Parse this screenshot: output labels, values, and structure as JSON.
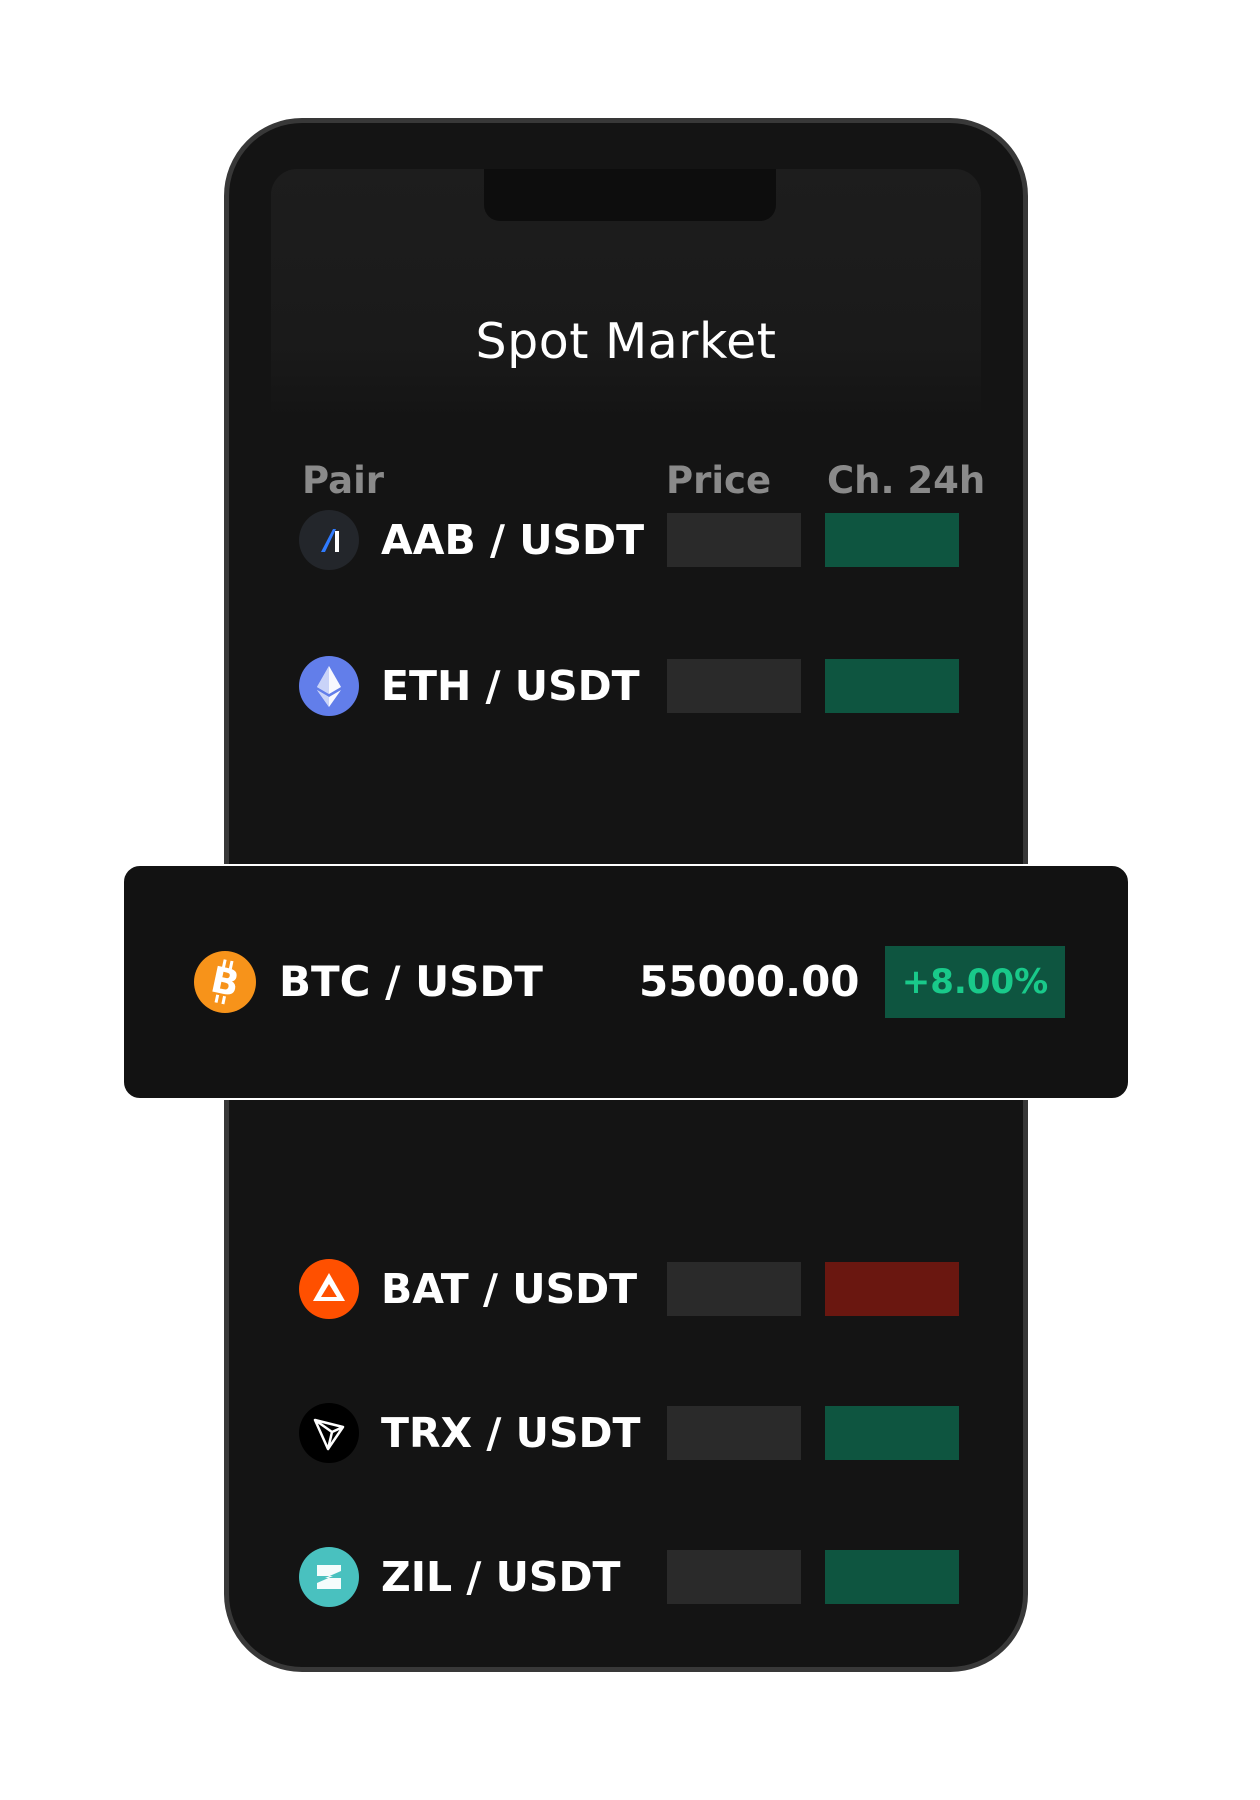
{
  "screen": {
    "title": "Spot Market"
  },
  "columns": {
    "pair": "Pair",
    "price": "Price",
    "change": "Ch. 24h"
  },
  "rows": [
    {
      "pair": "AAB / USDT",
      "icon": "aab-logo-icon",
      "trend": "up"
    },
    {
      "pair": "ETH / USDT",
      "icon": "ethereum-logo-icon",
      "trend": "up"
    },
    {
      "pair": "BAT / USDT",
      "icon": "bat-logo-icon",
      "trend": "down"
    },
    {
      "pair": "TRX / USDT",
      "icon": "tron-logo-icon",
      "trend": "up"
    },
    {
      "pair": "ZIL / USDT",
      "icon": "zilliqa-logo-icon",
      "trend": "up"
    }
  ],
  "highlight": {
    "pair": "BTC / USDT",
    "icon": "bitcoin-logo-icon",
    "price": "55000.00",
    "change": "+8.00%"
  },
  "colors": {
    "up": "#0e5540",
    "down": "#6a1710",
    "positive_text": "#19c98a",
    "bitcoin": "#f7931a",
    "ethereum": "#627eea",
    "bat": "#ff5000",
    "zilliqa": "#49c1bf"
  }
}
